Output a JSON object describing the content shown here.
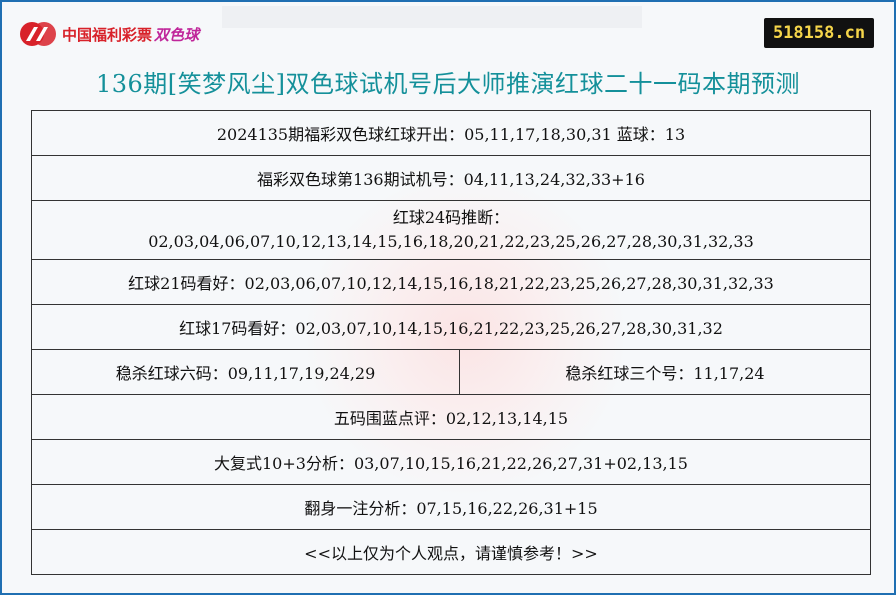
{
  "header": {
    "logo_text_1": "中国福利彩票",
    "logo_text_2": "双色球",
    "site_badge": "518158.cn",
    "title": "136期[笑梦风尘]双色球试机号后大师推演红球二十一码本期预测"
  },
  "rows": {
    "last_draw": "2024135期福彩双色球红球开出：05,11,17,18,30,31 蓝球：13",
    "test_numbers": "福彩双色球第136期试机号：04,11,13,24,32,33+16",
    "red24_label": "红球24码推断：",
    "red24_values": "02,03,04,06,07,10,12,13,14,15,16,18,20,21,22,23,25,26,27,28,30,31,32,33",
    "red21": "红球21码看好：02,03,06,07,10,12,14,15,16,18,21,22,23,25,26,27,28,30,31,32,33",
    "red17": "红球17码看好：02,03,07,10,14,15,16,21,22,23,25,26,27,28,30,31,32",
    "kill_six": "稳杀红球六码：09,11,17,19,24,29",
    "kill_three": "稳杀红球三个号：11,17,24",
    "blue_five": "五码围蓝点评：02,12,13,14,15",
    "big_combo": "大复式10+3分析：03,07,10,15,16,21,22,26,27,31+02,13,15",
    "single_bet": "翻身一注分析：07,15,16,22,26,31+15",
    "disclaimer": "<<以上仅为个人观点，请谨慎参考！>>"
  },
  "colors": {
    "title": "#14909a",
    "frame_border": "#1f6fb2",
    "badge_bg": "#111111",
    "badge_text": "#f5d54a",
    "logo_red": "#d8222a",
    "logo_magenta": "#c0269a"
  }
}
